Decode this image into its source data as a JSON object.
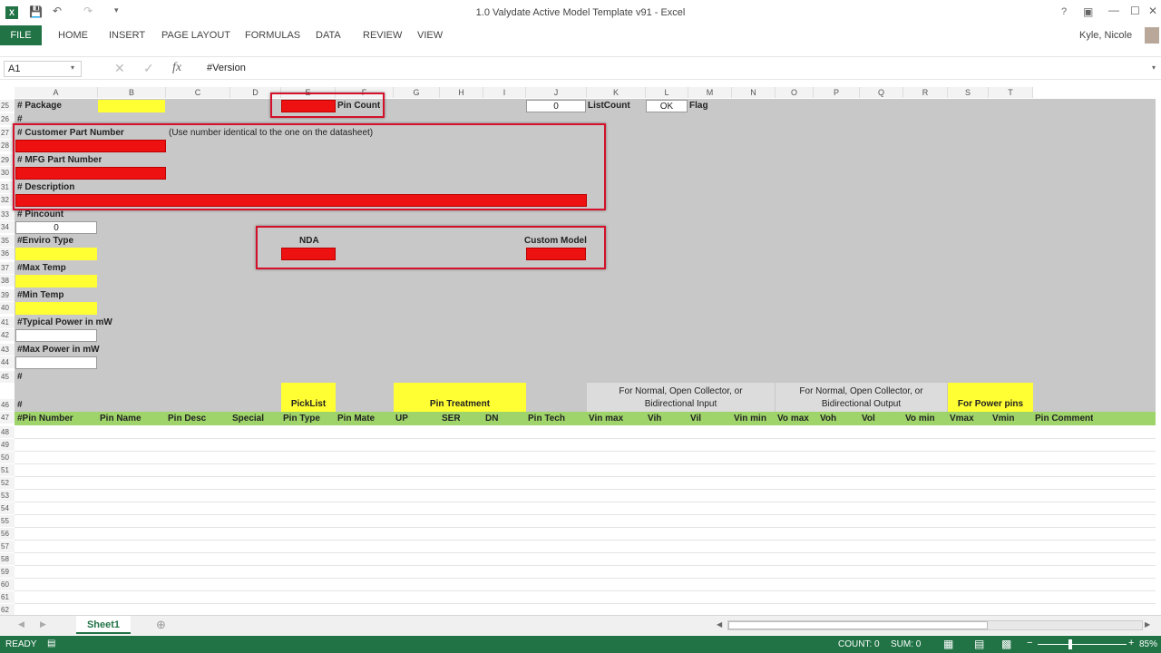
{
  "window": {
    "title": "1.0 Valydate Active Model Template v91 - Excel",
    "user": "Kyle, Nicole"
  },
  "ribbon": {
    "file": "FILE",
    "tabs": [
      "HOME",
      "INSERT",
      "PAGE LAYOUT",
      "FORMULAS",
      "DATA",
      "REVIEW",
      "VIEW"
    ]
  },
  "formula_bar": {
    "name_box": "A1",
    "fx": "fx",
    "formula": "#Version"
  },
  "columns": [
    "A",
    "B",
    "C",
    "D",
    "E",
    "F",
    "G",
    "H",
    "I",
    "J",
    "K",
    "L",
    "M",
    "N",
    "O",
    "P",
    "Q",
    "R",
    "S",
    "T"
  ],
  "rows": [
    "25",
    "26",
    "27",
    "28",
    "29",
    "30",
    "31",
    "32",
    "33",
    "34",
    "35",
    "36",
    "37",
    "38",
    "39",
    "40",
    "41",
    "42",
    "43",
    "44",
    "45",
    "46",
    "47",
    "48",
    "49",
    "50",
    "51",
    "52",
    "53",
    "54",
    "55",
    "56",
    "57",
    "58",
    "59",
    "60",
    "61",
    "62"
  ],
  "cells": {
    "package": "# Package",
    "pin_count": "Pin Count",
    "list_count_val": "0",
    "list_count": "ListCount",
    "ok": "OK",
    "flag": "Flag",
    "hash26": "#",
    "customer_pn": "# Customer Part Number",
    "note": "(Use number identical to the one on the datasheet)",
    "mfg_pn": "# MFG Part Number",
    "description": "# Description",
    "pincount": "# Pincount",
    "pincount_val": "0",
    "enviro": "#Enviro Type",
    "nda": "NDA",
    "custom_model": "Custom Model",
    "max_temp": "#Max Temp",
    "min_temp": "#Min Temp",
    "typ_power": "#Typical Power in mW",
    "max_power": "#Max Power in mW",
    "hash45": "#",
    "hash46": "#",
    "picklist": "PickList",
    "pin_treatment": "Pin Treatment",
    "input_group": "For Normal, Open Collector, or Bidirectional Input",
    "output_group": "For Normal, Open Collector, or Bidirectional Output",
    "power_group": "For Power pins"
  },
  "header_row": [
    "#Pin Number",
    "Pin Name",
    "Pin Desc",
    "Special",
    "Pin Type",
    "Pin Mate",
    "UP",
    "SER",
    "DN",
    "Pin Tech",
    "Vin max",
    "Vih",
    "Vil",
    "Vin min",
    "Vo max",
    "Voh",
    "Vol",
    "Vo min",
    "Vmax",
    "Vmin",
    "Pin Comment"
  ],
  "sheet_tab": "Sheet1",
  "status": {
    "ready": "READY",
    "count": "COUNT: 0",
    "sum": "SUM: 0",
    "zoom": "85%"
  },
  "colors": {
    "excel_green": "#217346",
    "header_green": "#9fd46a",
    "required_red": "#ee1111",
    "optional_yellow": "#ffff33"
  }
}
